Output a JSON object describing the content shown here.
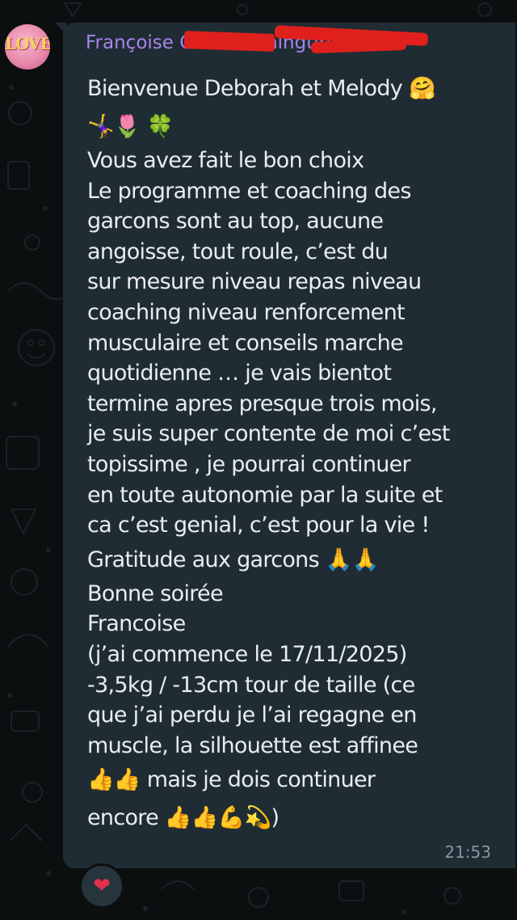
{
  "sender": {
    "name": "Françoise Chu      i Trainingtire",
    "avatar_text": "LOVE",
    "name_color": "#a685ec"
  },
  "message": {
    "lines": [
      "Bienvenue Deborah et Melody 🤗",
      "🤸‍♀️🌷 🍀",
      "Vous avez fait le bon choix",
      "Le programme et coaching des",
      "garcons sont au top, aucune",
      "angoisse, tout roule, c’est du",
      "sur mesure niveau repas niveau",
      "coaching niveau renforcement",
      "musculaire et conseils marche",
      "quotidienne … je vais bientot",
      "termine apres presque trois mois,",
      "je suis super contente de moi c’est",
      "topissime , je pourrai continuer",
      "en toute autonomie par la suite et",
      "ca c’est genial, c’est pour la vie !",
      "Gratitude aux garcons 🙏🙏",
      "Bonne soirée",
      "Francoise",
      " (j’ai commence le 17/11/2025)",
      "-3,5kg / -13cm tour de taille (ce",
      "que j’ai perdu je l’ai regagne en",
      "muscle, la silhouette est affinee",
      "👍👍 mais je dois continuer",
      "encore 👍👍💪💫)"
    ],
    "time": "21:53",
    "text_color": "#e9edef",
    "bubble_color": "#202c33"
  },
  "reaction": {
    "emoji": "❤",
    "emoji_name": "red-heart-icon"
  }
}
